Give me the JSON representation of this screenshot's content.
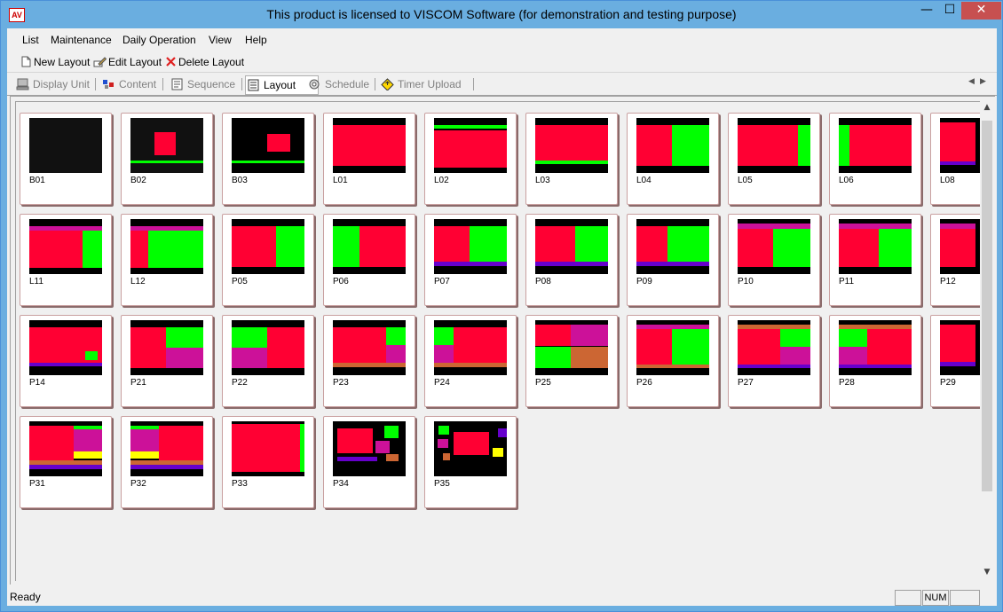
{
  "window": {
    "app_icon_text": "AV",
    "title": "This product is licensed to VISCOM Software (for demonstration and testing purpose)",
    "minimize": "—",
    "maximize": "☐",
    "close": "✕"
  },
  "menu": [
    "List",
    "Maintenance",
    "Daily Operation",
    "View",
    "Help"
  ],
  "toolbar": {
    "new_layout": "New Layout",
    "edit_layout": "Edit Layout",
    "delete_layout": "Delete Layout"
  },
  "tabs": [
    {
      "label": "Display Unit",
      "active": false
    },
    {
      "label": "Content",
      "active": false
    },
    {
      "label": "Sequence",
      "active": false
    },
    {
      "label": "Layout",
      "active": true
    },
    {
      "label": "Schedule",
      "active": false
    },
    {
      "label": "Timer Upload",
      "active": false
    }
  ],
  "layouts": [
    [
      "B01",
      "B02",
      "B03",
      "L01",
      "L02",
      "L03",
      "L04",
      "L05",
      "L06",
      "L08"
    ],
    [
      "L11",
      "L12",
      "P05",
      "P06",
      "P07",
      "P08",
      "P09",
      "P10",
      "P11",
      "P12"
    ],
    [
      "P14",
      "P21",
      "P22",
      "P23",
      "P24",
      "P25",
      "P26",
      "P27",
      "P28",
      "P29"
    ],
    [
      "P31",
      "P32",
      "P33",
      "P34",
      "P35"
    ]
  ],
  "colors": {
    "red": "#ff0033",
    "green": "#00ff00",
    "magenta": "#cc1199",
    "purple": "#6600cc",
    "orange": "#cc6633",
    "yellow": "#ffff00"
  },
  "status": {
    "text": "Ready",
    "num": "NUM"
  }
}
